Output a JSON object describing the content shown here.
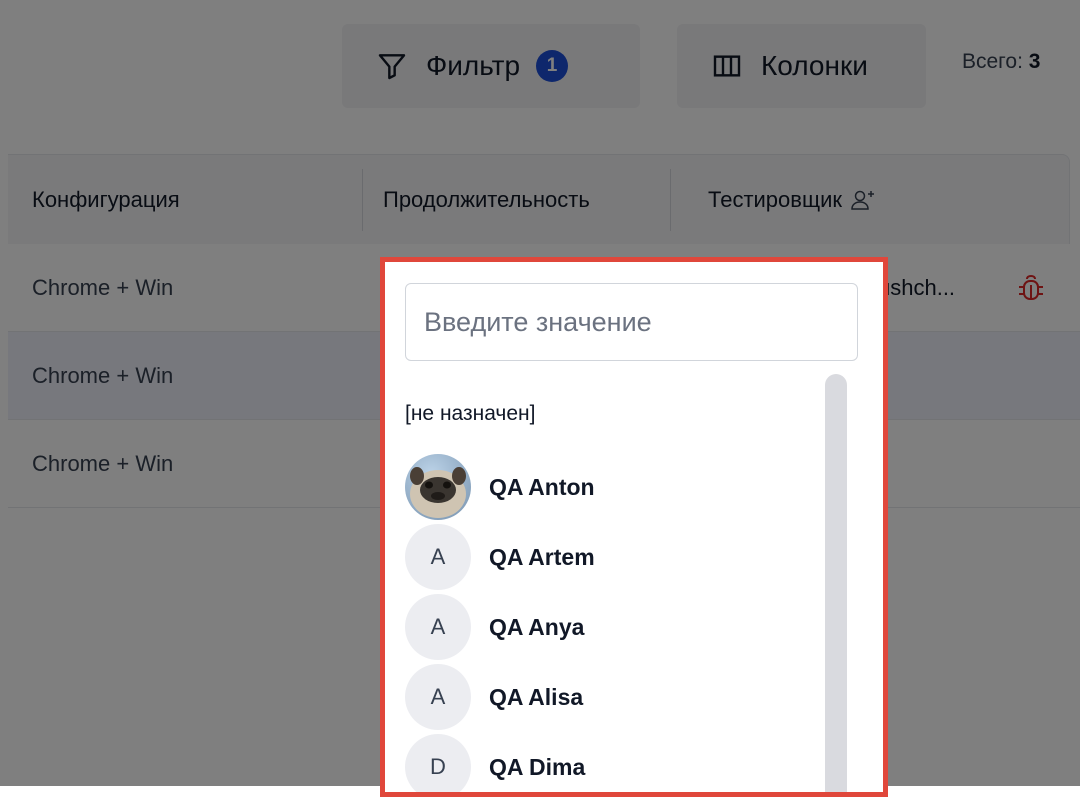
{
  "toolbar": {
    "filter_label": "Фильтр",
    "filter_count": "1",
    "columns_label": "Колонки",
    "total_label": "Всего:",
    "total_value": "3"
  },
  "table": {
    "headers": {
      "configuration": "Конфигурация",
      "duration": "Продолжительность",
      "tester": "Тестировщик"
    },
    "rows": [
      {
        "configuration": "Chrome + Win",
        "tester": "ushch..."
      },
      {
        "configuration": "Chrome + Win"
      },
      {
        "configuration": "Chrome + Win"
      }
    ]
  },
  "tester_dropdown": {
    "search_placeholder": "Введите значение",
    "unassigned_label": "[не назначен]",
    "options": [
      {
        "name": "QA Anton",
        "avatar": "photo"
      },
      {
        "name": "QA Artem",
        "initial": "A"
      },
      {
        "name": "QA Anya",
        "initial": "A"
      },
      {
        "name": "QA Alisa",
        "initial": "A"
      },
      {
        "name": "QA Dima",
        "initial": "D"
      }
    ]
  },
  "colors": {
    "accent": "#1d4ed8",
    "highlight_border": "#e0473b",
    "bug_icon": "#dc2626"
  },
  "icons": {
    "filter": "funnel-icon",
    "columns": "columns-icon",
    "tester_header": "person-plus-icon",
    "bug": "bug-icon"
  }
}
